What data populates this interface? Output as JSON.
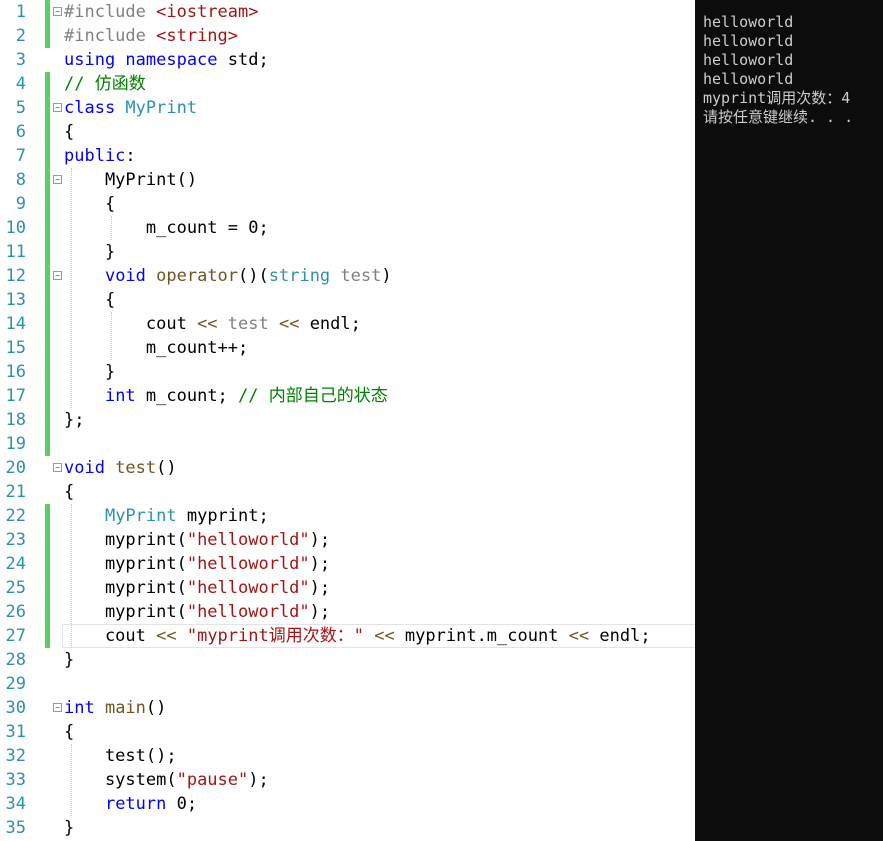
{
  "editor": {
    "language": "cpp",
    "colors": {
      "keyword": "#0000ff",
      "type": "#2b91af",
      "string": "#a31515",
      "comment": "#008000",
      "preprocessor": "#808080",
      "line_number": "#2b91af",
      "changed_bar": "#57d162"
    },
    "lines": [
      {
        "n": "1",
        "changed": true,
        "fold": true,
        "tokens": [
          {
            "c": "pp",
            "t": "#include "
          },
          {
            "c": "st",
            "t": "<iostream>"
          }
        ]
      },
      {
        "n": "2",
        "changed": true,
        "fold": false,
        "tokens": [
          {
            "c": "pp",
            "t": "#include "
          },
          {
            "c": "st",
            "t": "<string>"
          }
        ]
      },
      {
        "n": "3",
        "changed": false,
        "fold": false,
        "tokens": [
          {
            "c": "kw",
            "t": "using namespace "
          },
          {
            "c": "",
            "t": "std;"
          }
        ]
      },
      {
        "n": "4",
        "changed": true,
        "fold": false,
        "tokens": [
          {
            "c": "cm",
            "t": "// 仿函数"
          }
        ]
      },
      {
        "n": "5",
        "changed": true,
        "fold": true,
        "tokens": [
          {
            "c": "kw",
            "t": "class "
          },
          {
            "c": "ty",
            "t": "MyPrint"
          }
        ]
      },
      {
        "n": "6",
        "changed": true,
        "fold": false,
        "tokens": [
          {
            "c": "",
            "t": "{"
          }
        ]
      },
      {
        "n": "7",
        "changed": true,
        "fold": false,
        "tokens": [
          {
            "c": "kw",
            "t": "public"
          },
          {
            "c": "",
            "t": ":"
          }
        ]
      },
      {
        "n": "8",
        "changed": true,
        "fold": true,
        "tokens": [
          {
            "c": "",
            "t": "    MyPrint()"
          }
        ]
      },
      {
        "n": "9",
        "changed": true,
        "fold": false,
        "tokens": [
          {
            "c": "",
            "t": "    {"
          }
        ]
      },
      {
        "n": "10",
        "changed": true,
        "fold": false,
        "tokens": [
          {
            "c": "",
            "t": "        m_count = 0;"
          }
        ]
      },
      {
        "n": "11",
        "changed": true,
        "fold": false,
        "tokens": [
          {
            "c": "",
            "t": "    }"
          }
        ]
      },
      {
        "n": "12",
        "changed": true,
        "fold": true,
        "tokens": [
          {
            "c": "",
            "t": "    "
          },
          {
            "c": "kw",
            "t": "void "
          },
          {
            "c": "fn",
            "t": "operator"
          },
          {
            "c": "",
            "t": "()("
          },
          {
            "c": "ty",
            "t": "string "
          },
          {
            "c": "pa",
            "t": "test"
          },
          {
            "c": "",
            "t": ")"
          }
        ]
      },
      {
        "n": "13",
        "changed": true,
        "fold": false,
        "tokens": [
          {
            "c": "",
            "t": "    {"
          }
        ]
      },
      {
        "n": "14",
        "changed": true,
        "fold": false,
        "tokens": [
          {
            "c": "",
            "t": "        cout "
          },
          {
            "c": "fn",
            "t": "<< "
          },
          {
            "c": "pa",
            "t": "test "
          },
          {
            "c": "fn",
            "t": "<< "
          },
          {
            "c": "",
            "t": "endl;"
          }
        ]
      },
      {
        "n": "15",
        "changed": true,
        "fold": false,
        "tokens": [
          {
            "c": "",
            "t": "        m_count++;"
          }
        ]
      },
      {
        "n": "16",
        "changed": true,
        "fold": false,
        "tokens": [
          {
            "c": "",
            "t": "    }"
          }
        ]
      },
      {
        "n": "17",
        "changed": true,
        "fold": false,
        "tokens": [
          {
            "c": "",
            "t": "    "
          },
          {
            "c": "kw",
            "t": "int "
          },
          {
            "c": "",
            "t": "m_count; "
          },
          {
            "c": "cm",
            "t": "// 内部自己的状态"
          }
        ]
      },
      {
        "n": "18",
        "changed": true,
        "fold": false,
        "tokens": [
          {
            "c": "",
            "t": "};"
          }
        ]
      },
      {
        "n": "19",
        "changed": true,
        "fold": false,
        "tokens": []
      },
      {
        "n": "20",
        "changed": false,
        "fold": true,
        "tokens": [
          {
            "c": "kw",
            "t": "void "
          },
          {
            "c": "fn",
            "t": "test"
          },
          {
            "c": "",
            "t": "()"
          }
        ]
      },
      {
        "n": "21",
        "changed": false,
        "fold": false,
        "tokens": [
          {
            "c": "",
            "t": "{"
          }
        ]
      },
      {
        "n": "22",
        "changed": true,
        "fold": false,
        "tokens": [
          {
            "c": "",
            "t": "    "
          },
          {
            "c": "ty",
            "t": "MyPrint "
          },
          {
            "c": "",
            "t": "myprint;"
          }
        ]
      },
      {
        "n": "23",
        "changed": true,
        "fold": false,
        "tokens": [
          {
            "c": "",
            "t": "    myprint("
          },
          {
            "c": "st",
            "t": "\"helloworld\""
          },
          {
            "c": "",
            "t": ");"
          }
        ]
      },
      {
        "n": "24",
        "changed": true,
        "fold": false,
        "tokens": [
          {
            "c": "",
            "t": "    myprint("
          },
          {
            "c": "st",
            "t": "\"helloworld\""
          },
          {
            "c": "",
            "t": ");"
          }
        ]
      },
      {
        "n": "25",
        "changed": true,
        "fold": false,
        "tokens": [
          {
            "c": "",
            "t": "    myprint("
          },
          {
            "c": "st",
            "t": "\"helloworld\""
          },
          {
            "c": "",
            "t": ");"
          }
        ]
      },
      {
        "n": "26",
        "changed": true,
        "fold": false,
        "tokens": [
          {
            "c": "",
            "t": "    myprint("
          },
          {
            "c": "st",
            "t": "\"helloworld\""
          },
          {
            "c": "",
            "t": ");"
          }
        ]
      },
      {
        "n": "27",
        "changed": true,
        "fold": false,
        "current": true,
        "tokens": [
          {
            "c": "",
            "t": "    cout "
          },
          {
            "c": "fn",
            "t": "<< "
          },
          {
            "c": "st",
            "t": "\"myprint调用次数：\" "
          },
          {
            "c": "fn",
            "t": "<< "
          },
          {
            "c": "",
            "t": "myprint.m_count "
          },
          {
            "c": "fn",
            "t": "<< "
          },
          {
            "c": "",
            "t": "endl;"
          }
        ]
      },
      {
        "n": "28",
        "changed": false,
        "fold": false,
        "tokens": [
          {
            "c": "",
            "t": "}"
          }
        ]
      },
      {
        "n": "29",
        "changed": false,
        "fold": false,
        "tokens": []
      },
      {
        "n": "30",
        "changed": false,
        "fold": true,
        "tokens": [
          {
            "c": "kw",
            "t": "int "
          },
          {
            "c": "fn",
            "t": "main"
          },
          {
            "c": "",
            "t": "()"
          }
        ]
      },
      {
        "n": "31",
        "changed": false,
        "fold": false,
        "tokens": [
          {
            "c": "",
            "t": "{"
          }
        ]
      },
      {
        "n": "32",
        "changed": false,
        "fold": false,
        "tokens": [
          {
            "c": "",
            "t": "    test();"
          }
        ]
      },
      {
        "n": "33",
        "changed": false,
        "fold": false,
        "tokens": [
          {
            "c": "",
            "t": "    system("
          },
          {
            "c": "st",
            "t": "\"pause\""
          },
          {
            "c": "",
            "t": ");"
          }
        ]
      },
      {
        "n": "34",
        "changed": false,
        "fold": false,
        "tokens": [
          {
            "c": "",
            "t": "    "
          },
          {
            "c": "kw",
            "t": "return "
          },
          {
            "c": "",
            "t": "0;"
          }
        ]
      },
      {
        "n": "35",
        "changed": false,
        "fold": false,
        "tokens": [
          {
            "c": "",
            "t": "}"
          }
        ]
      }
    ]
  },
  "console": {
    "background": "#0c0c0c",
    "text_color": "#cccccc",
    "lines": [
      "helloworld",
      "helloworld",
      "helloworld",
      "helloworld",
      "myprint调用次数：4",
      "请按任意键继续. . ."
    ]
  }
}
